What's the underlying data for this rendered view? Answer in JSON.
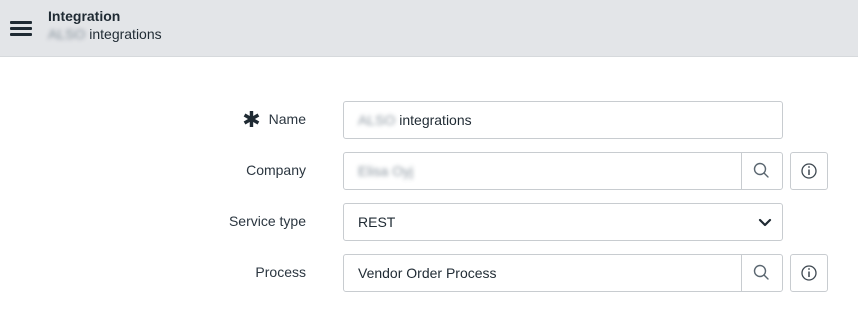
{
  "header": {
    "title": "Integration",
    "subtitle_blurred": "ALSO",
    "subtitle": "integrations"
  },
  "form": {
    "name": {
      "label": "Name",
      "required": true,
      "value_blurred": "ALSO",
      "value": "integrations"
    },
    "company": {
      "label": "Company",
      "value_blurred": "Elisa Oyj"
    },
    "service_type": {
      "label": "Service type",
      "value": "REST"
    },
    "process": {
      "label": "Process",
      "value": "Vendor Order Process"
    }
  },
  "icons": {
    "menu": "hamburger-menu-icon",
    "lookup": "search-icon",
    "info": "info-icon",
    "dropdown": "chevron-down-icon",
    "required": "asterisk-icon"
  }
}
